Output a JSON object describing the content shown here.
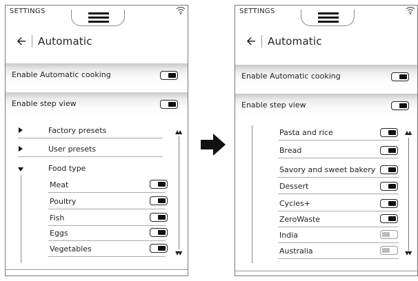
{
  "left": {
    "status": {
      "settings_label": "SETTINGS",
      "menu_icon": "hamburger-icon",
      "wifi_icon": "wifi-icon"
    },
    "title": "Automatic",
    "bands": [
      {
        "label": "Enable Automatic cooking",
        "toggle": "on"
      },
      {
        "label": "Enable step view",
        "toggle": "on"
      }
    ],
    "groups": [
      {
        "label": "Factory presets",
        "state": "collapsed"
      },
      {
        "label": "User presets",
        "state": "collapsed"
      },
      {
        "label": "Food type",
        "state": "expanded"
      }
    ],
    "food_items": [
      {
        "label": "Meat",
        "toggle": "on"
      },
      {
        "label": "Poultry",
        "toggle": "on"
      },
      {
        "label": "Fish",
        "toggle": "on"
      },
      {
        "label": "Eggs",
        "toggle": "on"
      },
      {
        "label": "Vegetables",
        "toggle": "on"
      }
    ]
  },
  "right": {
    "status": {
      "settings_label": "SETTINGS",
      "menu_icon": "hamburger-icon",
      "wifi_icon": "wifi-icon"
    },
    "title": "Automatic",
    "bands": [
      {
        "label": "Enable Automatic cooking",
        "toggle": "on"
      },
      {
        "label": "Enable step view",
        "toggle": "on"
      }
    ],
    "food_items": [
      {
        "label": "Pasta and rice",
        "toggle": "on"
      },
      {
        "label": "Bread",
        "toggle": "on"
      },
      {
        "label": "Savory and sweet bakery",
        "toggle": "on"
      },
      {
        "label": "Dessert",
        "toggle": "on"
      },
      {
        "label": "Cycles+",
        "toggle": "on"
      },
      {
        "label": "ZeroWaste",
        "toggle": "on"
      },
      {
        "label": "India",
        "toggle": "off"
      },
      {
        "label": "Australia",
        "toggle": "off"
      }
    ]
  },
  "transition_icon": "arrow-right-icon",
  "colors": {
    "toggle_on": "#111111",
    "toggle_off": "#bbbbbb",
    "band_shadow": "#c9c9c9"
  }
}
